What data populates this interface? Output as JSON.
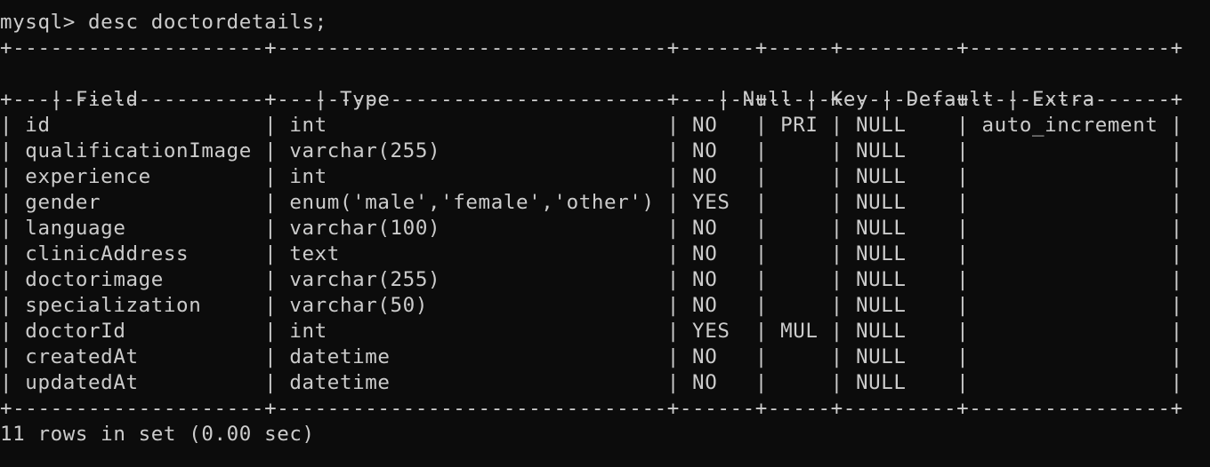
{
  "terminal": {
    "prompt": "mysql> ",
    "command": "desc doctordetails;",
    "border": "+--------------------+-------------------------------+------+-----+---------+----------------+",
    "header": {
      "field": "Field",
      "type": "Type",
      "null": "Null",
      "key": "Key",
      "default": "Default",
      "extra": "Extra"
    },
    "rows": [
      {
        "field": "id",
        "type": "int",
        "null": "NO",
        "key": "PRI",
        "default": "NULL",
        "extra": "auto_increment"
      },
      {
        "field": "qualificationImage",
        "type": "varchar(255)",
        "null": "NO",
        "key": "",
        "default": "NULL",
        "extra": ""
      },
      {
        "field": "experience",
        "type": "int",
        "null": "NO",
        "key": "",
        "default": "NULL",
        "extra": ""
      },
      {
        "field": "gender",
        "type": "enum('male','female','other')",
        "null": "YES",
        "key": "",
        "default": "NULL",
        "extra": ""
      },
      {
        "field": "language",
        "type": "varchar(100)",
        "null": "NO",
        "key": "",
        "default": "NULL",
        "extra": ""
      },
      {
        "field": "clinicAddress",
        "type": "text",
        "null": "NO",
        "key": "",
        "default": "NULL",
        "extra": ""
      },
      {
        "field": "doctorimage",
        "type": "varchar(255)",
        "null": "NO",
        "key": "",
        "default": "NULL",
        "extra": ""
      },
      {
        "field": "specialization",
        "type": "varchar(50)",
        "null": "NO",
        "key": "",
        "default": "NULL",
        "extra": ""
      },
      {
        "field": "doctorId",
        "type": "int",
        "null": "YES",
        "key": "MUL",
        "default": "NULL",
        "extra": ""
      },
      {
        "field": "createdAt",
        "type": "datetime",
        "null": "NO",
        "key": "",
        "default": "NULL",
        "extra": ""
      },
      {
        "field": "updatedAt",
        "type": "datetime",
        "null": "NO",
        "key": "",
        "default": "NULL",
        "extra": ""
      }
    ],
    "result": "11 rows in set (0.00 sec)",
    "colors": {
      "background": "#0c0c0c",
      "text": "#cccccc"
    }
  }
}
